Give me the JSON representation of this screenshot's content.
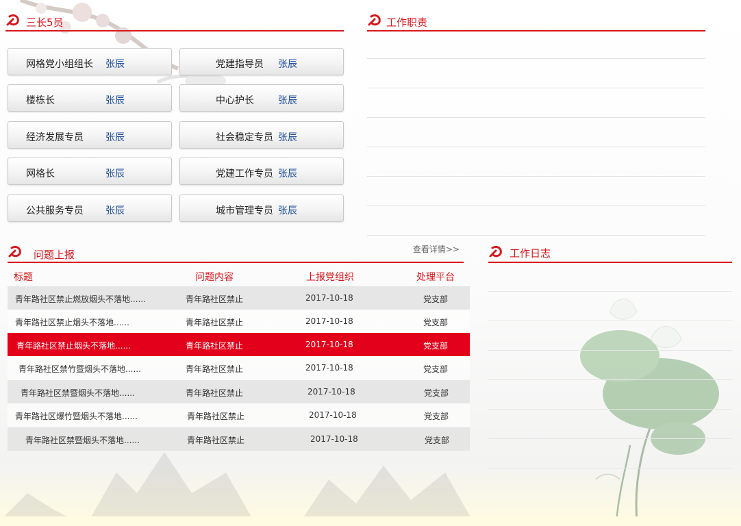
{
  "leaders": {
    "title": "三长5员",
    "cards": [
      {
        "role": "网格党小组组长",
        "name": "张辰"
      },
      {
        "role": "党建指导员",
        "name": "张辰"
      },
      {
        "role": "楼栋长",
        "name": "张辰"
      },
      {
        "role": "中心护长",
        "name": "张辰"
      },
      {
        "role": "经济发展专员",
        "name": "张辰"
      },
      {
        "role": "社会稳定专员",
        "name": "张辰"
      },
      {
        "role": "网格长",
        "name": "张辰"
      },
      {
        "role": "党建工作专员",
        "name": "张辰"
      },
      {
        "role": "公共服务专员",
        "name": "张辰"
      },
      {
        "role": "城市管理专员",
        "name": "张辰"
      }
    ]
  },
  "duties": {
    "title": "工作职责"
  },
  "issues": {
    "title": "问题上报",
    "more_label": "查看详情>>",
    "columns": [
      "标题",
      "问题内容",
      "上报党组织",
      "处理平台"
    ],
    "rows": [
      {
        "title": "青年路社区禁止燃放烟头不落地......",
        "content": "青年路社区禁止",
        "date": "2017-10-18",
        "platform": "党支部"
      },
      {
        "title": "青年路社区禁止烟头不落地......",
        "content": "青年路社区禁止",
        "date": "2017-10-18",
        "platform": "党支部"
      },
      {
        "title": "青年路社区禁止烟头不落地......",
        "content": "青年路社区禁止",
        "date": "2017-10-18",
        "platform": "党支部"
      },
      {
        "title": "青年路社区禁竹暨烟头不落地......",
        "content": "青年路社区禁止",
        "date": "2017-10-18",
        "platform": "党支部"
      },
      {
        "title": "青年路社区禁暨烟头不落地......",
        "content": "青年路社区禁止",
        "date": "2017-10-18",
        "platform": "党支部"
      },
      {
        "title": "青年路社区爆竹暨烟头不落地......",
        "content": "青年路社区禁止",
        "date": "2017-10-18",
        "platform": "党支部"
      },
      {
        "title": "青年路社区禁暨烟头不落地......",
        "content": "青年路社区禁止",
        "date": "2017-10-18",
        "platform": "党支部"
      }
    ],
    "active_row": 3
  },
  "worklog": {
    "title": "工作日志"
  },
  "colors": {
    "accent_red": "#d7171c",
    "active_row": "#e3001a",
    "name_blue": "#1f4e9c",
    "row_gray": "#e4e4e4"
  },
  "icons": {
    "section_emblem": "party-emblem-icon"
  }
}
